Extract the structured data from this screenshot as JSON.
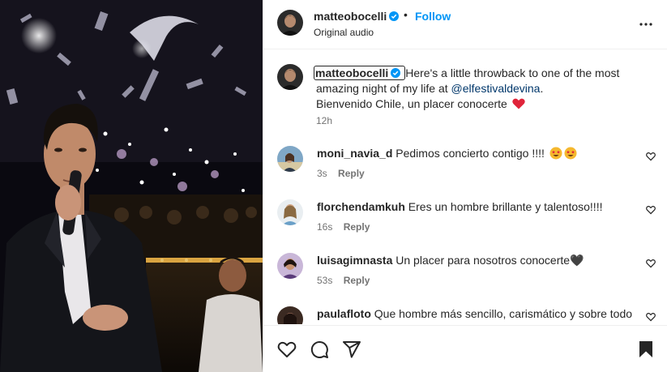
{
  "post": {
    "author": "matteobocelli",
    "follow_label": "Follow",
    "separator": "•",
    "audio_label": "Original audio",
    "more_icon": "more-horizontal-icon"
  },
  "caption": {
    "username": "matteobocelli",
    "text_part1": "Here's a little throwback to one of the most amazing night of my life at ",
    "mention": "@elfestivaldevina",
    "text_part2": ".",
    "line2": "Bienvenido Chile, un placer conocerte",
    "emoji": "red-heart",
    "time": "12h"
  },
  "comments": [
    {
      "username": "moni_navia_d",
      "text": "Pedimos concierto contigo !!!! ",
      "emojis": [
        "star-struck",
        "star-struck"
      ],
      "time": "3s",
      "reply_label": "Reply"
    },
    {
      "username": "florchendamkuh",
      "text": "Eres un hombre brillante y talentoso!!!!",
      "time": "16s",
      "reply_label": "Reply"
    },
    {
      "username": "luisagimnasta",
      "text": "Un placer para nosotros conocerte🖤",
      "time": "53s",
      "reply_label": "Reply"
    },
    {
      "username": "paulafloto",
      "text": "Que hombre más sencillo, carismático y sobre todo",
      "time": "",
      "reply_label": ""
    }
  ],
  "actions": [
    "heart-icon",
    "comment-icon",
    "share-icon",
    "save-icon"
  ],
  "colors": {
    "link_blue": "#0095f6",
    "mention": "#00376b",
    "verified": "#0095f6",
    "heart": "#ed4956",
    "muted": "#737373"
  }
}
